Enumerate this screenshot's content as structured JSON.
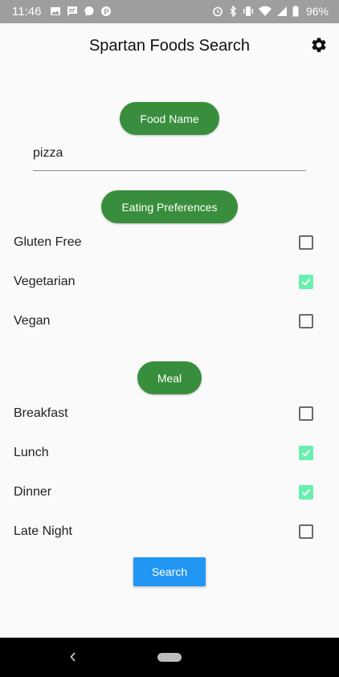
{
  "status_bar": {
    "time": "11:46",
    "battery": "96%"
  },
  "app_bar": {
    "title": "Spartan Foods Search"
  },
  "food_section": {
    "label": "Food Name",
    "input_value": "pizza",
    "input_placeholder": ""
  },
  "preferences_section": {
    "label": "Eating Preferences",
    "items": [
      {
        "label": "Gluten Free",
        "checked": false
      },
      {
        "label": "Vegetarian",
        "checked": true
      },
      {
        "label": "Vegan",
        "checked": false
      }
    ]
  },
  "meal_section": {
    "label": "Meal",
    "items": [
      {
        "label": "Breakfast",
        "checked": false
      },
      {
        "label": "Lunch",
        "checked": true
      },
      {
        "label": "Dinner",
        "checked": true
      },
      {
        "label": "Late Night",
        "checked": false
      }
    ]
  },
  "search_button": {
    "label": "Search"
  },
  "colors": {
    "accent_green": "#388e3c",
    "checkbox_checked": "#69f0ae",
    "search_blue": "#2196f3"
  }
}
